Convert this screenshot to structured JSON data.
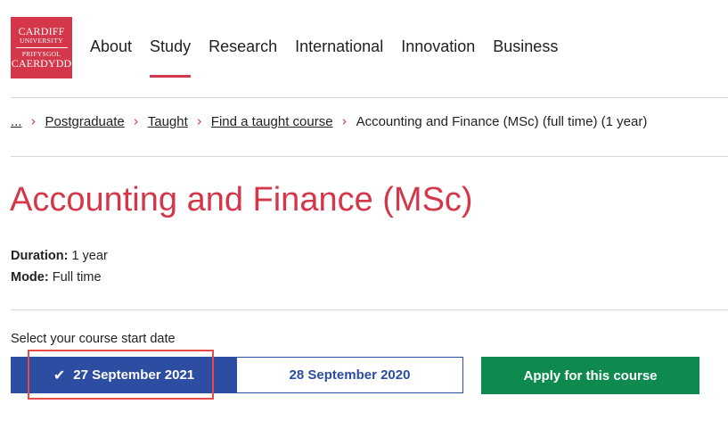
{
  "header": {
    "logo": {
      "line1": "CARDIFF",
      "line2": "UNIVERSITY",
      "line3": "PRIFYSGOL",
      "line4": "CAERDYDD"
    },
    "nav": [
      {
        "label": "About",
        "active": false
      },
      {
        "label": "Study",
        "active": true
      },
      {
        "label": "Research",
        "active": false
      },
      {
        "label": "International",
        "active": false
      },
      {
        "label": "Innovation",
        "active": false
      },
      {
        "label": "Business",
        "active": false
      }
    ]
  },
  "breadcrumb": {
    "ellipsis": "...",
    "items": [
      "Postgraduate",
      "Taught",
      "Find a taught course"
    ],
    "current": "Accounting and Finance (MSc) (full time) (1 year)",
    "separator_icon": "chevron-right-icon"
  },
  "course": {
    "title": "Accounting and Finance (MSc)",
    "duration_label": "Duration:",
    "duration_value": "1 year",
    "mode_label": "Mode:",
    "mode_value": "Full time"
  },
  "start_date": {
    "label": "Select your course start date",
    "options": [
      {
        "label": "27 September 2021",
        "selected": true
      },
      {
        "label": "28 September 2020",
        "selected": false
      }
    ]
  },
  "apply_button": "Apply for this course",
  "colors": {
    "brand_red": "#d4374a",
    "selected_blue": "#2c4da1",
    "apply_green": "#0e8a4f",
    "highlight_red": "#e84a4a"
  }
}
